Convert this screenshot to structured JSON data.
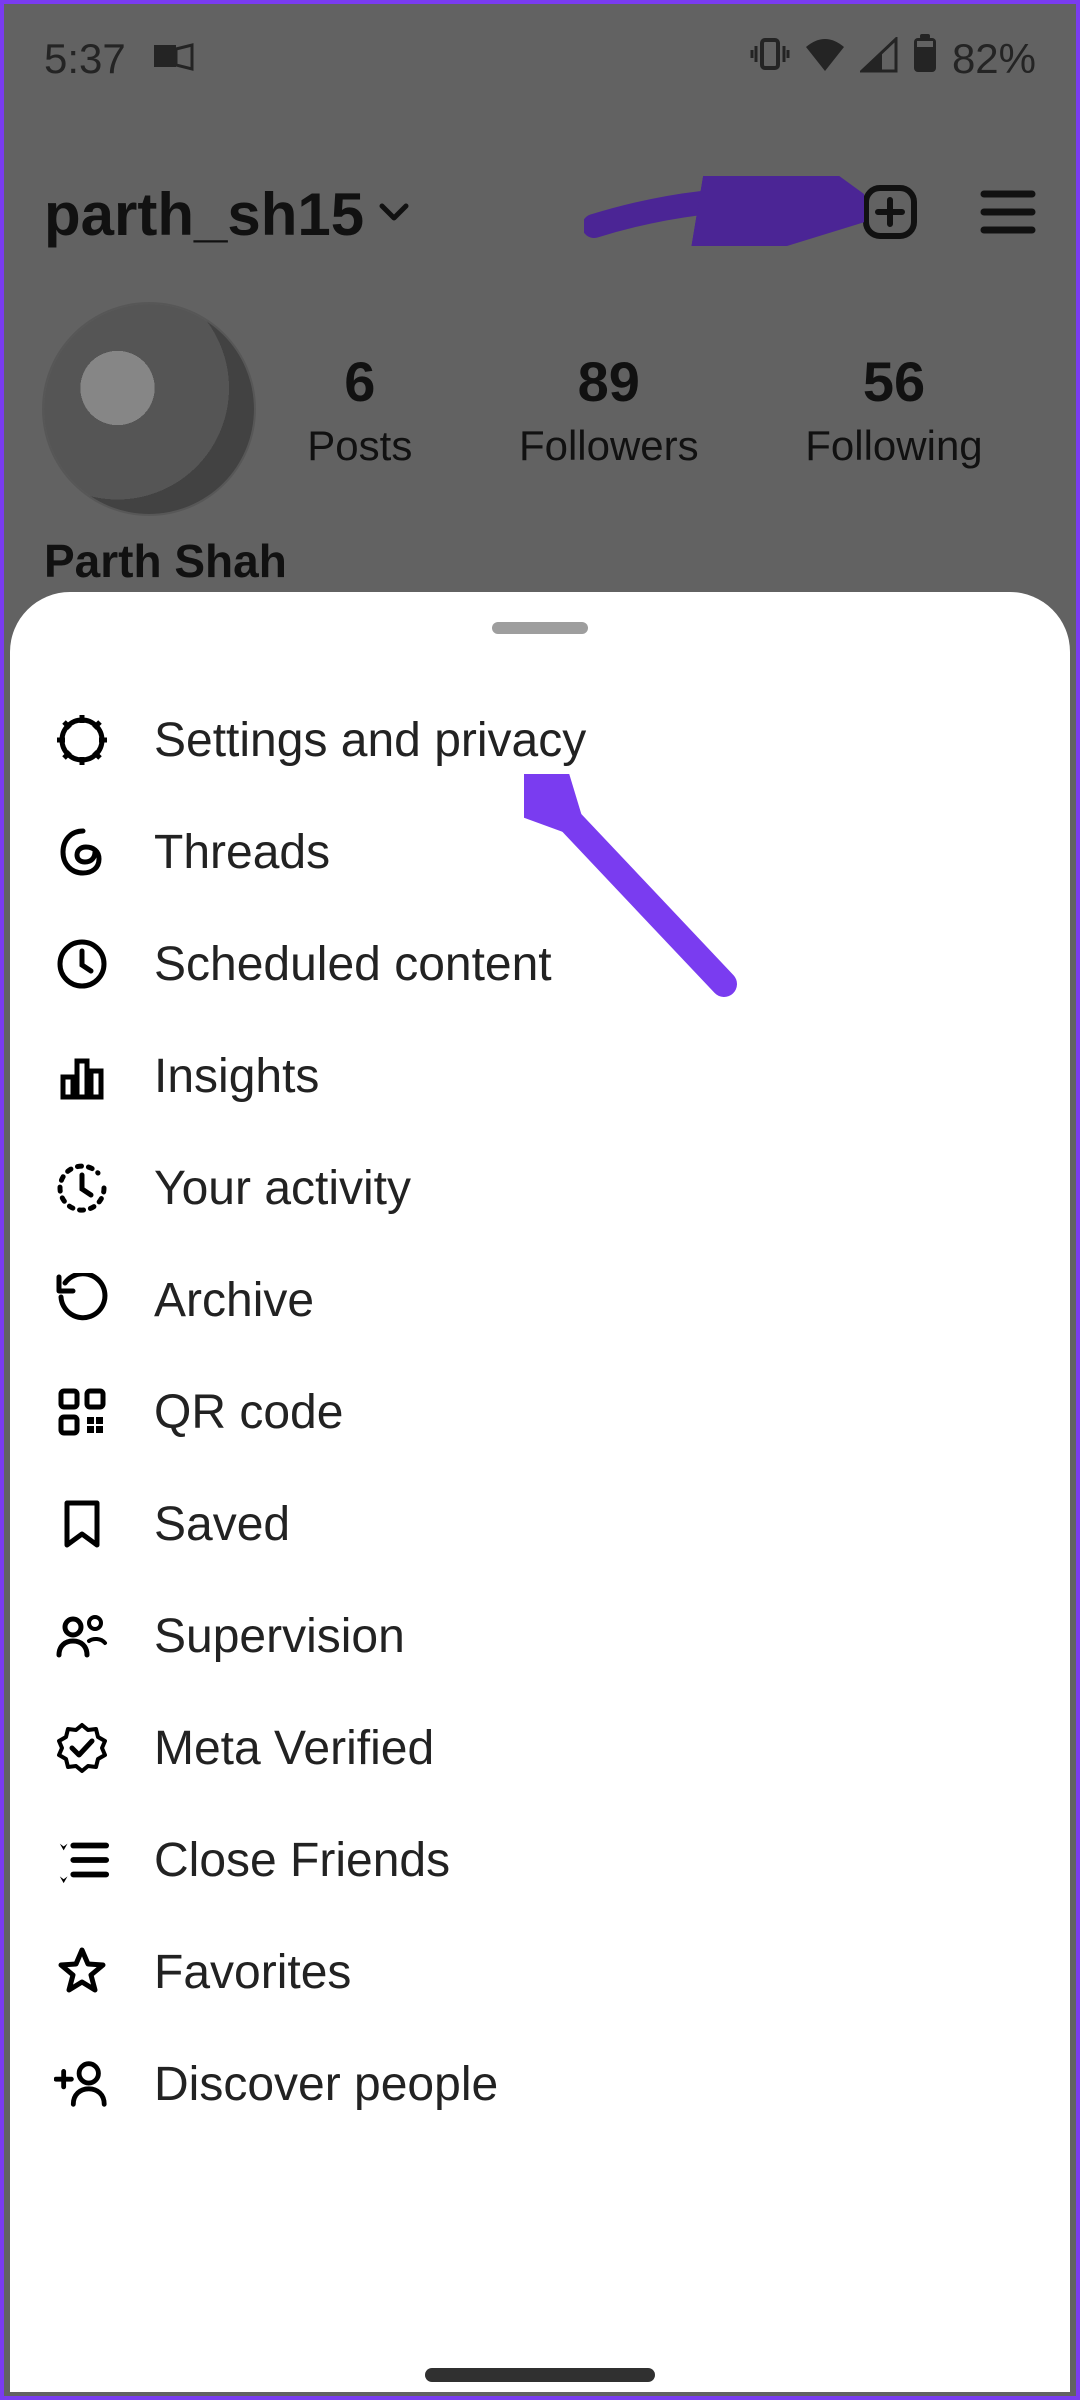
{
  "status": {
    "time": "5:37",
    "battery_pct": "82%"
  },
  "profile": {
    "username": "parth_sh15",
    "display_name": "Parth Shah",
    "stats": {
      "posts": {
        "value": "6",
        "label": "Posts"
      },
      "followers": {
        "value": "89",
        "label": "Followers"
      },
      "following": {
        "value": "56",
        "label": "Following"
      }
    }
  },
  "menu": {
    "items": [
      {
        "label": "Settings and privacy",
        "icon": "gear-icon"
      },
      {
        "label": "Threads",
        "icon": "threads-icon"
      },
      {
        "label": "Scheduled content",
        "icon": "clock-icon"
      },
      {
        "label": "Insights",
        "icon": "bar-chart-icon"
      },
      {
        "label": "Your activity",
        "icon": "activity-icon"
      },
      {
        "label": "Archive",
        "icon": "archive-icon"
      },
      {
        "label": "QR code",
        "icon": "qr-code-icon"
      },
      {
        "label": "Saved",
        "icon": "bookmark-icon"
      },
      {
        "label": "Supervision",
        "icon": "supervision-icon"
      },
      {
        "label": "Meta Verified",
        "icon": "verified-badge-icon"
      },
      {
        "label": "Close Friends",
        "icon": "close-friends-icon"
      },
      {
        "label": "Favorites",
        "icon": "star-icon"
      },
      {
        "label": "Discover people",
        "icon": "add-person-icon"
      }
    ]
  },
  "annotation": {
    "arrow_color": "#7a3cf0"
  }
}
